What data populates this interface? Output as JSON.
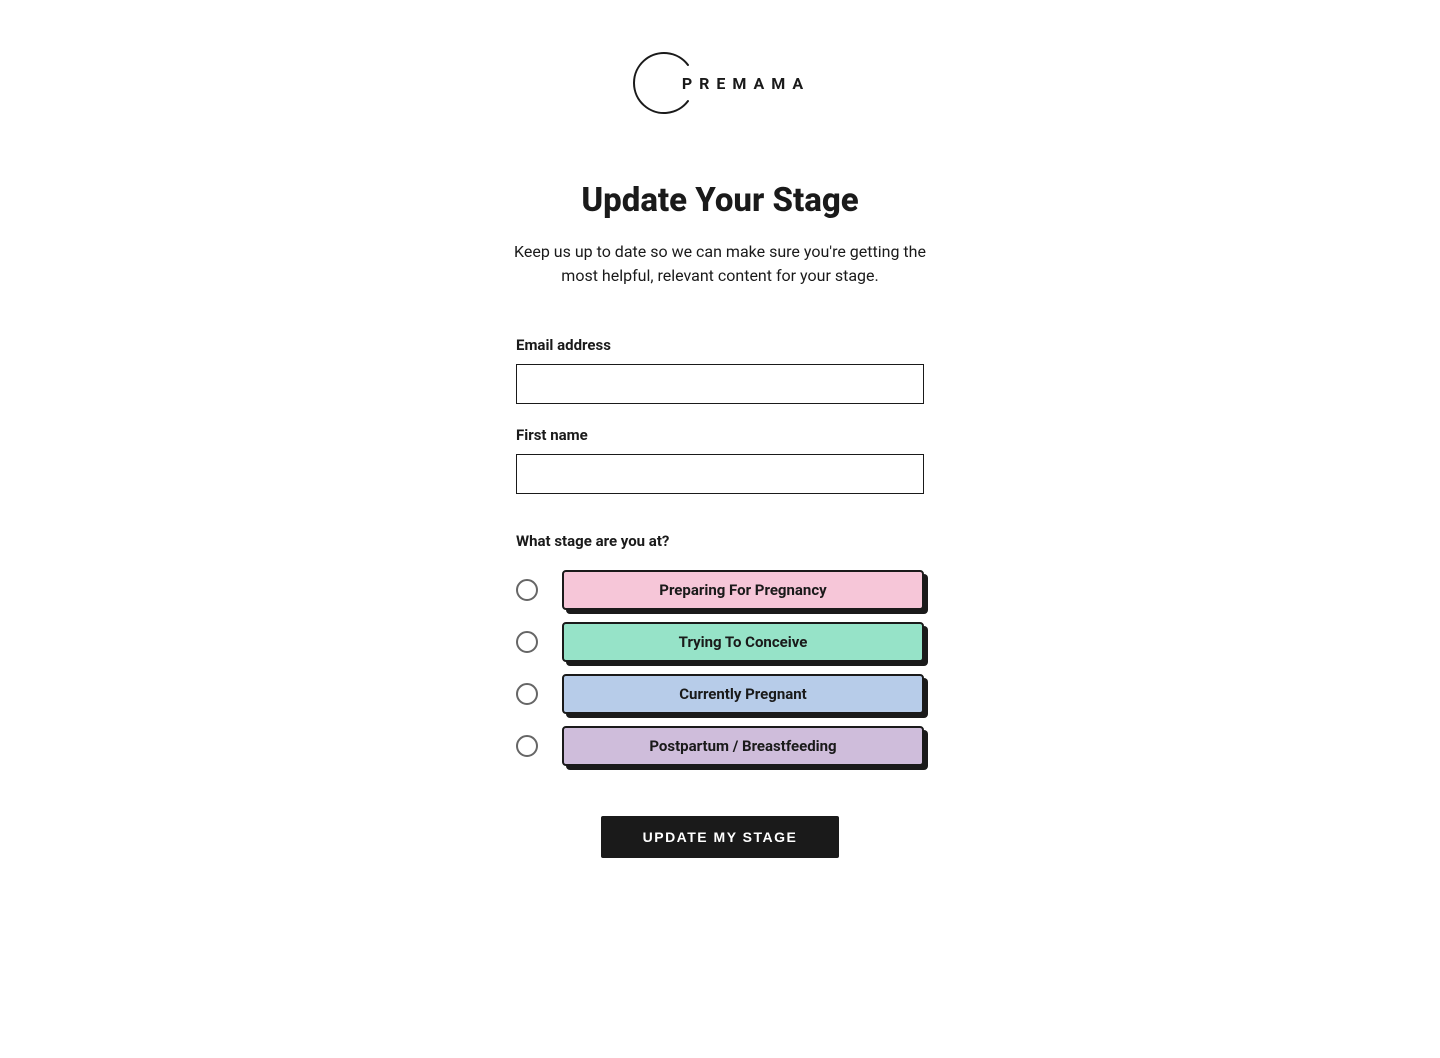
{
  "logo": {
    "text": "PREMAMA"
  },
  "heading": "Update Your Stage",
  "subheading": "Keep us up to date so we can make sure you're getting the most helpful, relevant content for your stage.",
  "form": {
    "email": {
      "label": "Email address",
      "value": ""
    },
    "firstName": {
      "label": "First name",
      "value": ""
    },
    "stage": {
      "label": "What stage are you at?",
      "options": [
        {
          "label": "Preparing For Pregnancy",
          "colorClass": "pill-pink"
        },
        {
          "label": "Trying To Conceive",
          "colorClass": "pill-mint"
        },
        {
          "label": "Currently Pregnant",
          "colorClass": "pill-blue"
        },
        {
          "label": "Postpartum / Breastfeeding",
          "colorClass": "pill-lilac"
        }
      ]
    },
    "submit": {
      "label": "UPDATE MY STAGE"
    }
  }
}
